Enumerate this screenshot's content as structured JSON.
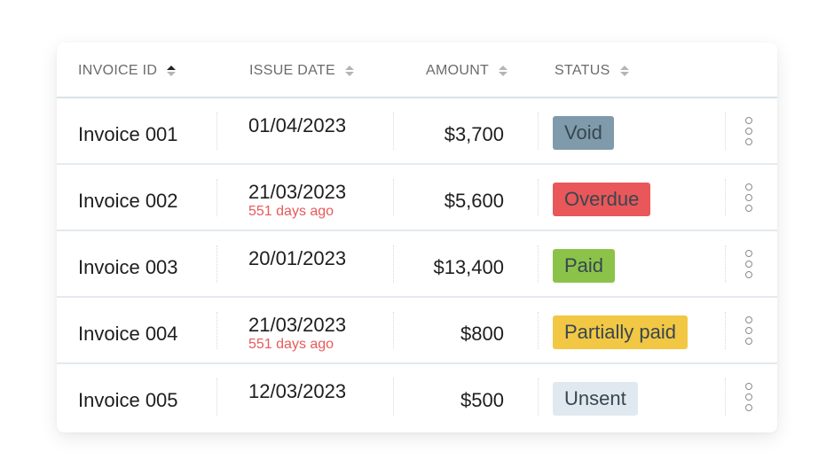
{
  "table": {
    "columns": [
      {
        "label": "INVOICE ID",
        "sort": "ascending"
      },
      {
        "label": "ISSUE DATE",
        "sort": "none"
      },
      {
        "label": "AMOUNT",
        "sort": "none"
      },
      {
        "label": "STATUS",
        "sort": "none"
      }
    ],
    "rows": [
      {
        "invoice": "Invoice 001",
        "date": "01/04/2023",
        "overdue_note": null,
        "amount": "$3,700",
        "status": "Void",
        "status_color": "#7f9aab",
        "menu_icon": "kebab-menu-icon"
      },
      {
        "invoice": "Invoice 002",
        "date": "21/03/2023",
        "overdue_note": "551 days ago",
        "amount": "$5,600",
        "status": "Overdue",
        "status_color": "#e9575a",
        "menu_icon": "kebab-menu-icon"
      },
      {
        "invoice": "Invoice 003",
        "date": "20/01/2023",
        "overdue_note": null,
        "amount": "$13,400",
        "status": "Paid",
        "status_color": "#8bc34a",
        "menu_icon": "kebab-menu-icon"
      },
      {
        "invoice": "Invoice 004",
        "date": "21/03/2023",
        "overdue_note": "551 days ago",
        "amount": "$800",
        "status": "Partially paid",
        "status_color": "#f2c744",
        "menu_icon": "kebab-menu-icon"
      },
      {
        "invoice": "Invoice 005",
        "date": "12/03/2023",
        "overdue_note": null,
        "amount": "$500",
        "status": "Unsent",
        "status_color": "#e1e9f0",
        "menu_icon": "kebab-menu-icon"
      }
    ]
  },
  "colors": {
    "overdue_text": "#e85a5a",
    "badge_text": "#37474f",
    "header_text": "#6b6b6b"
  }
}
